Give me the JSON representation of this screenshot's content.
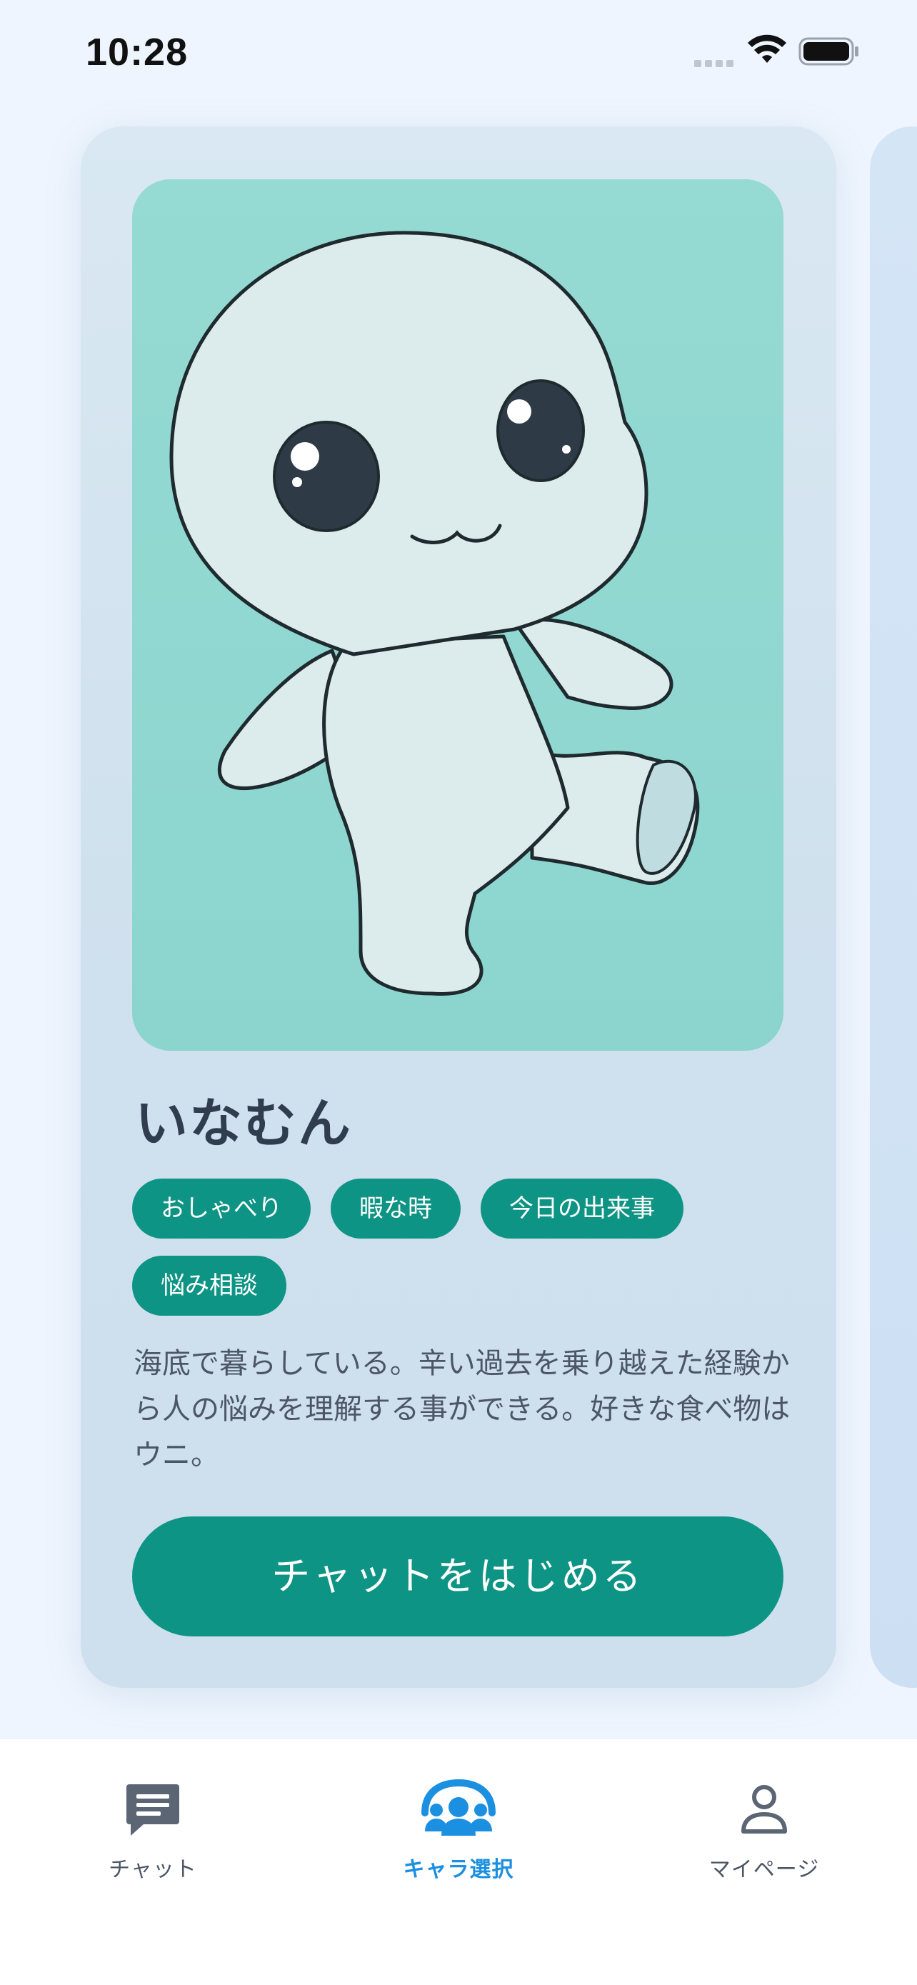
{
  "status_bar": {
    "time": "10:28"
  },
  "character": {
    "name": "いなむん",
    "tags": [
      "おしゃべり",
      "暇な時",
      "今日の出来事",
      "悩み相談"
    ],
    "description": "海底で暮らしている。辛い過去を乗り越えた経験から人の悩みを理解する事ができる。好きな食べ物はウニ。",
    "start_button_label": "チャットをはじめる",
    "image_background_color": "#92d8d2"
  },
  "bottom_nav": {
    "items": [
      {
        "label": "チャット",
        "icon": "chat-icon",
        "active": false
      },
      {
        "label": "キャラ選択",
        "icon": "characters-icon",
        "active": true
      },
      {
        "label": "マイページ",
        "icon": "user-icon",
        "active": false
      }
    ]
  },
  "colors": {
    "accent": "#0e9484",
    "nav_active": "#1b8fe0",
    "background": "#eef5fe"
  }
}
